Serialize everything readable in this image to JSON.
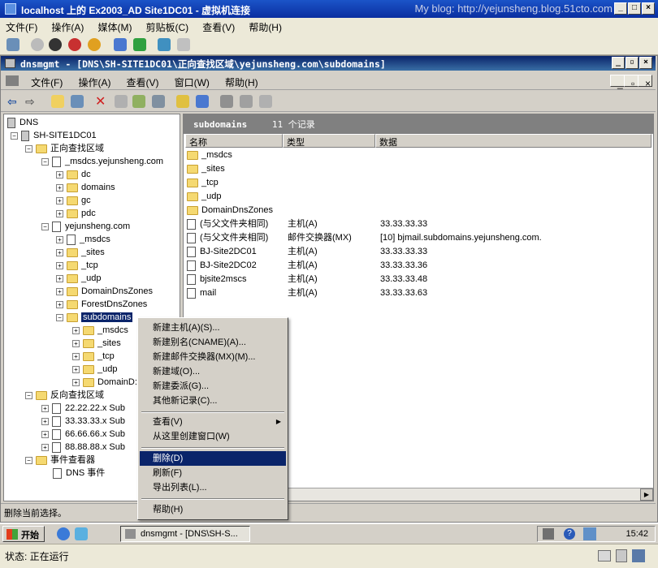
{
  "outer": {
    "title": "localhost 上的 Ex2003_AD Site1DC01 - 虚拟机连接",
    "watermark": "My blog: http://yejunsheng.blog.51cto.com",
    "menu": [
      "文件(F)",
      "操作(A)",
      "媒体(M)",
      "剪贴板(C)",
      "查看(V)",
      "帮助(H)"
    ]
  },
  "mmc": {
    "title": "dnsmgmt - [DNS\\SH-SITE1DC01\\正向查找区域\\yejunsheng.com\\subdomains]",
    "menu": [
      "文件(F)",
      "操作(A)",
      "查看(V)",
      "窗口(W)",
      "帮助(H)"
    ]
  },
  "tree": {
    "root": "DNS",
    "server": "SH-SITE1DC01",
    "forward": "正向查找区域",
    "msdcs_zone": "_msdcs.yejunsheng.com",
    "msdcs_children": [
      "dc",
      "domains",
      "gc",
      "pdc"
    ],
    "zone": "yejunsheng.com",
    "zone_children": [
      "_msdcs",
      "_sites",
      "_tcp",
      "_udp",
      "DomainDnsZones",
      "ForestDnsZones"
    ],
    "selected": "subdomains",
    "sub_children": [
      "_msdcs",
      "_sites",
      "_tcp",
      "_udp",
      "DomainD:"
    ],
    "reverse": "反向查找区域",
    "reverse_children": [
      "22.22.22.x Sub",
      "33.33.33.x Sub",
      "66.66.66.x Sub",
      "88.88.88.x Sub"
    ],
    "events": "事件查看器",
    "dns_events": "DNS 事件"
  },
  "list": {
    "header_name": "subdomains",
    "header_count": "11 个记录",
    "columns": [
      "名称",
      "类型",
      "数据"
    ],
    "rows": [
      {
        "icon": "folder",
        "name": "_msdcs",
        "type": "",
        "data": ""
      },
      {
        "icon": "folder",
        "name": "_sites",
        "type": "",
        "data": ""
      },
      {
        "icon": "folder",
        "name": "_tcp",
        "type": "",
        "data": ""
      },
      {
        "icon": "folder",
        "name": "_udp",
        "type": "",
        "data": ""
      },
      {
        "icon": "folder",
        "name": "DomainDnsZones",
        "type": "",
        "data": ""
      },
      {
        "icon": "record",
        "name": "(与父文件夹相同)",
        "type": "主机(A)",
        "data": "33.33.33.33"
      },
      {
        "icon": "record",
        "name": "(与父文件夹相同)",
        "type": "邮件交换器(MX)",
        "data": "[10]  bjmail.subdomains.yejunsheng.com."
      },
      {
        "icon": "record",
        "name": "BJ-Site2DC01",
        "type": "主机(A)",
        "data": "33.33.33.33"
      },
      {
        "icon": "record",
        "name": "BJ-Site2DC02",
        "type": "主机(A)",
        "data": "33.33.33.36"
      },
      {
        "icon": "record",
        "name": "bjsite2mscs",
        "type": "主机(A)",
        "data": "33.33.33.48"
      },
      {
        "icon": "record",
        "name": "mail",
        "type": "主机(A)",
        "data": "33.33.33.63"
      }
    ]
  },
  "context_menu": {
    "group1": [
      "新建主机(A)(S)...",
      "新建别名(CNAME)(A)...",
      "新建邮件交换器(MX)(M)...",
      "新建域(O)...",
      "新建委派(G)...",
      "其他新记录(C)..."
    ],
    "group2": [
      "查看(V)",
      "从这里创建窗口(W)"
    ],
    "group3": [
      "删除(D)",
      "刷新(F)",
      "导出列表(L)..."
    ],
    "group4": [
      "帮助(H)"
    ],
    "highlighted": "删除(D)"
  },
  "status": "删除当前选择。",
  "taskbar": {
    "start": "开始",
    "task": "dnsmgmt - [DNS\\SH-S...",
    "clock": "15:42"
  },
  "vm_status": "状态: 正在运行"
}
